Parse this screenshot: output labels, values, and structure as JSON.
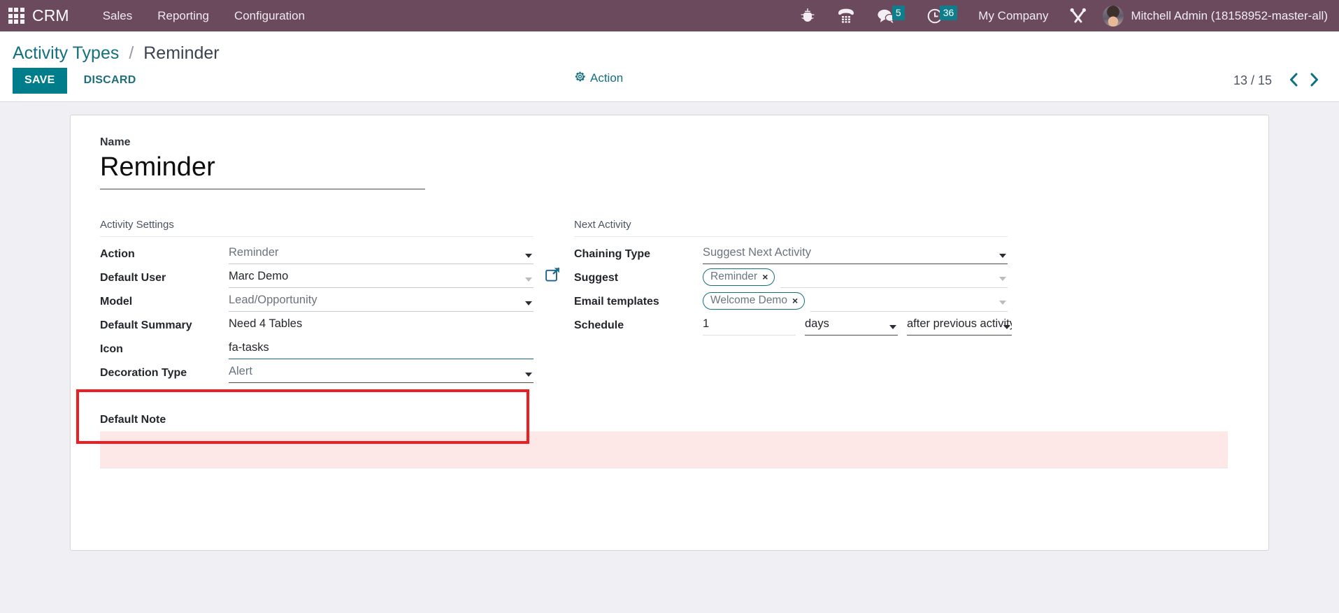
{
  "navbar": {
    "apps_icon": "apps-grid-icon",
    "brand": "CRM",
    "menus": [
      {
        "label": "Sales"
      },
      {
        "label": "Reporting"
      },
      {
        "label": "Configuration"
      }
    ],
    "sys_icons": [
      {
        "name": "bug-icon",
        "badge": null
      },
      {
        "name": "phone-keypad-icon",
        "badge": null
      },
      {
        "name": "messages-icon",
        "badge": "5"
      },
      {
        "name": "activity-clock-icon",
        "badge": "36"
      }
    ],
    "company": "My Company",
    "tools_icon": "wrench-screwdriver-icon",
    "avatar": "user-avatar",
    "user": "Mitchell Admin (18158952-master-all)",
    "bg_color": "#6b4a5e",
    "badge_color": "#0e7e8c"
  },
  "control_panel": {
    "breadcrumb": {
      "parent": "Activity Types",
      "separator": "/",
      "current": "Reminder"
    },
    "save_label": "SAVE",
    "discard_label": "DISCARD",
    "action_label": "Action",
    "action_icon": "gear-icon",
    "pager": {
      "count": "13 / 15",
      "prev_icon": "chevron-left-icon",
      "next_icon": "chevron-right-icon"
    },
    "accent_color": "#007d8b"
  },
  "form": {
    "name": {
      "label": "Name",
      "value": "Reminder"
    },
    "activity_settings": {
      "title": "Activity Settings",
      "fields": [
        {
          "label": "Action",
          "value": "Reminder",
          "widget": "select"
        },
        {
          "label": "Default User",
          "value": "Marc Demo",
          "widget": "many2one",
          "external_link_icon": "external-link-icon"
        },
        {
          "label": "Model",
          "value": "Lead/Opportunity",
          "widget": "select"
        },
        {
          "label": "Default Summary",
          "value": "Need 4 Tables",
          "widget": "text"
        },
        {
          "label": "Icon",
          "value": "fa-tasks",
          "widget": "text"
        },
        {
          "label": "Decoration Type",
          "value": "Alert",
          "widget": "select"
        }
      ]
    },
    "next_activity": {
      "title": "Next Activity",
      "chaining_type": {
        "label": "Chaining Type",
        "value": "Suggest Next Activity"
      },
      "suggest": {
        "label": "Suggest",
        "tags": [
          "Reminder"
        ],
        "remove_icon": "×"
      },
      "email_templates": {
        "label": "Email templates",
        "tags": [
          "Welcome Demo"
        ],
        "remove_icon": "×"
      },
      "schedule": {
        "label": "Schedule",
        "amount": "1",
        "unit": "days",
        "reference": "after previous activity"
      }
    },
    "default_note": {
      "label": "Default Note",
      "value": "",
      "background": "#fde8e7"
    }
  },
  "annotation": {
    "highlight_color": "#ee1d22",
    "highlighted_fields": [
      "Icon",
      "Decoration Type"
    ]
  }
}
